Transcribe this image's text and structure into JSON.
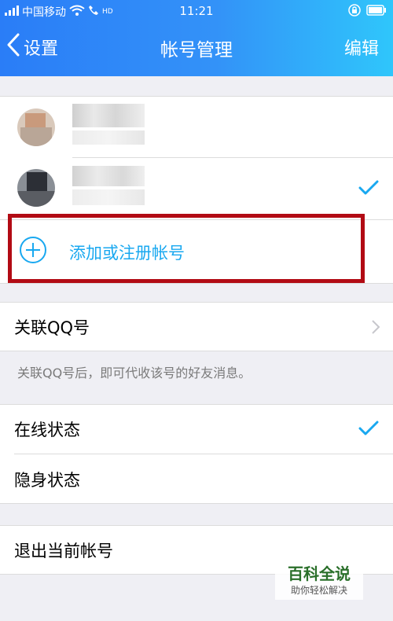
{
  "status_bar": {
    "carrier": "中国移动",
    "time": "11:21",
    "hd": "HD"
  },
  "nav": {
    "back_label": "设置",
    "title": "帐号管理",
    "edit_label": "编辑"
  },
  "accounts": [
    {
      "name": "",
      "checked": false
    },
    {
      "name": "",
      "checked": true
    }
  ],
  "add_account": {
    "label": "添加或注册帐号"
  },
  "linked_qq": {
    "label": "关联QQ号",
    "hint": "关联QQ号后，即可代收该号的好友消息。"
  },
  "status_options": [
    {
      "label": "在线状态",
      "selected": true
    },
    {
      "label": "隐身状态",
      "selected": false
    }
  ],
  "logout": {
    "label": "退出当前帐号"
  },
  "watermark": {
    "title": "百科全说",
    "subtitle": "助你轻松解决"
  },
  "colors": {
    "accent": "#19a8f0",
    "header_start": "#2a7df7",
    "header_end": "#2fc6fb",
    "highlight_border": "#b20b14"
  }
}
